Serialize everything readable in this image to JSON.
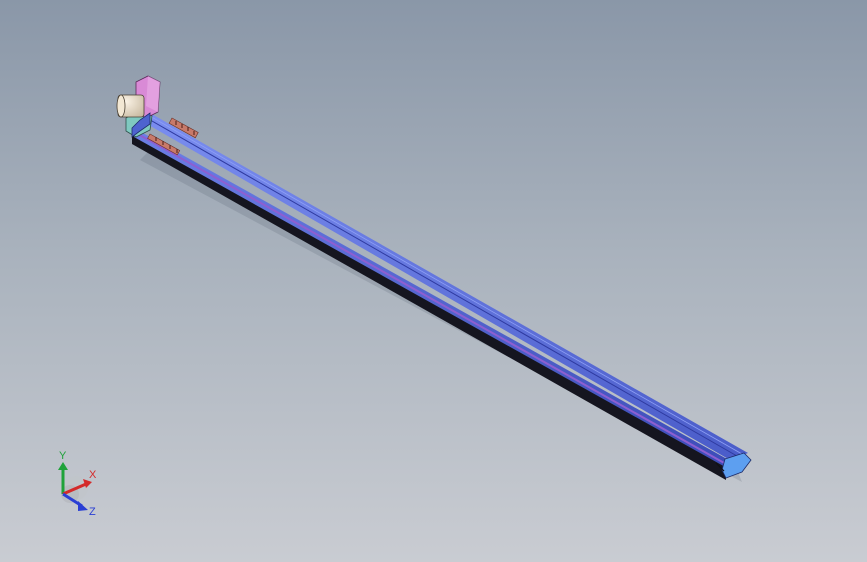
{
  "viewport": {
    "background_top": "#8a97a8",
    "background_bottom": "#c9ccd2"
  },
  "model": {
    "rail_color": "#5b6fd6",
    "rail_dark": "#1a1a26",
    "motor_color": "#e9dcc9",
    "bracket_color": "#d98ad6",
    "coupling_color": "#7fc9c0",
    "bolt_color": "#c87a6a",
    "endcap_color": "#5d9ff0"
  },
  "triad": {
    "x_label": "X",
    "y_label": "Y",
    "z_label": "Z",
    "x_color": "#d42a2a",
    "y_color": "#1fa23a",
    "z_color": "#2a3fd4"
  }
}
